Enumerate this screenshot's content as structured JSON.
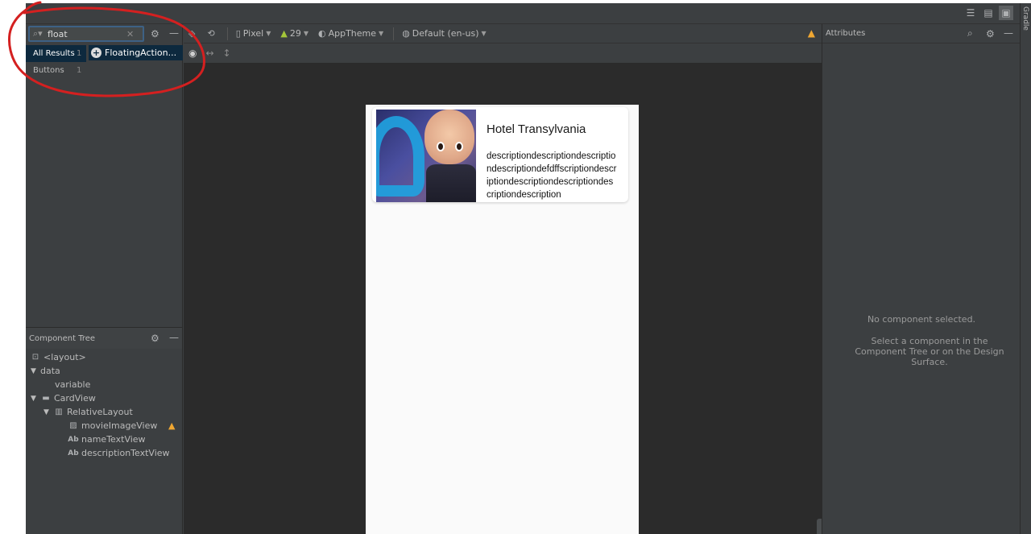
{
  "palette": {
    "search_value": "float",
    "categories": [
      {
        "label": "All Results",
        "count": "1"
      },
      {
        "label": "Buttons",
        "count": "1"
      }
    ],
    "results": [
      {
        "label": "FloatingAction..."
      }
    ]
  },
  "component_tree": {
    "title": "Component Tree",
    "nodes": [
      {
        "label": "<layout>"
      },
      {
        "label": "data"
      },
      {
        "label": "variable"
      },
      {
        "label": "CardView"
      },
      {
        "label": "RelativeLayout"
      },
      {
        "label": "movieImageView"
      },
      {
        "label": "nameTextView"
      },
      {
        "label": "descriptionTextView"
      }
    ]
  },
  "design_toolbar": {
    "device": "Pixel",
    "api": "29",
    "theme": "AppTheme",
    "locale": "Default (en-us)"
  },
  "preview": {
    "movie_name": "Hotel Transylvania",
    "description": "descriptiondescriptiondescriptiondescriptiondefdffscriptiondescriptiondescriptiondescriptiondescriptiondescription"
  },
  "attributes": {
    "title": "Attributes",
    "empty_title": "No component selected.",
    "empty_hint": "Select a component in the Component Tree or on the Design Surface."
  },
  "side_strip": {
    "label": "Gradle"
  },
  "colors": {
    "panel_bg": "#3c3f41",
    "canvas_bg": "#2b2b2b",
    "selection": "#0d293e",
    "warning": "#f0a732",
    "annotation": "#d42020"
  }
}
